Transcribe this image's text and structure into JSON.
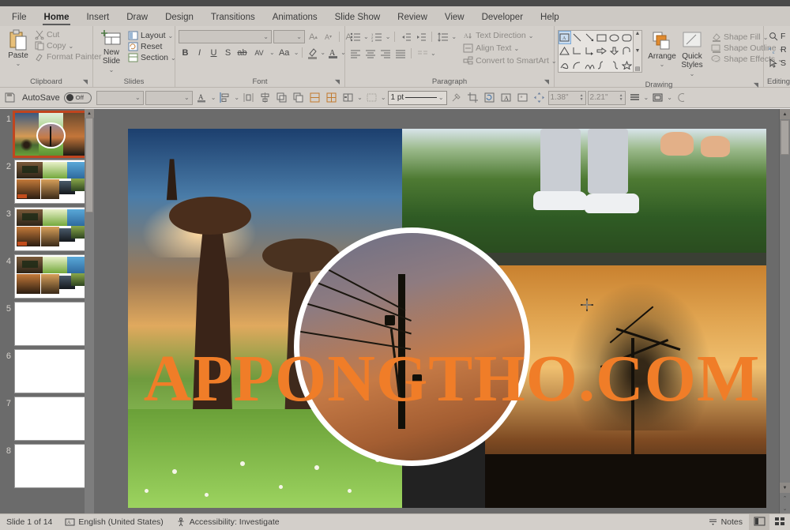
{
  "tabs": [
    {
      "label": "File",
      "active": false
    },
    {
      "label": "Home",
      "active": true
    },
    {
      "label": "Insert",
      "active": false
    },
    {
      "label": "Draw",
      "active": false
    },
    {
      "label": "Design",
      "active": false
    },
    {
      "label": "Transitions",
      "active": false
    },
    {
      "label": "Animations",
      "active": false
    },
    {
      "label": "Slide Show",
      "active": false
    },
    {
      "label": "Review",
      "active": false
    },
    {
      "label": "View",
      "active": false
    },
    {
      "label": "Developer",
      "active": false
    },
    {
      "label": "Help",
      "active": false
    }
  ],
  "ribbon": {
    "clipboard": {
      "label": "Clipboard",
      "paste": "Paste",
      "cut": "Cut",
      "copy": "Copy",
      "format_painter": "Format Painter"
    },
    "slides": {
      "label": "Slides",
      "new_slide": "New\nSlide",
      "new_slide_line1": "New",
      "new_slide_line2": "Slide",
      "layout": "Layout",
      "reset": "Reset",
      "section": "Section"
    },
    "font": {
      "label": "Font",
      "font_name_value": "",
      "font_name_placeholder": "",
      "font_size_value": "",
      "bold": "B",
      "italic": "I",
      "underline": "U",
      "shadow": "S",
      "strikethrough": "ab",
      "char_spacing": "AV",
      "change_case": "Aa",
      "increase_size": "A",
      "decrease_size": "A",
      "clear_formatting": "A",
      "text_highlight": "A",
      "font_color": "A"
    },
    "paragraph": {
      "label": "Paragraph",
      "text_direction": "Text Direction",
      "align_text": "Align Text",
      "convert_smartart": "Convert to SmartArt"
    },
    "drawing": {
      "label": "Drawing",
      "arrange": "Arrange",
      "quick_styles_line1": "Quick",
      "quick_styles_line2": "Styles",
      "shape_fill": "Shape Fill",
      "shape_outline": "Shape Outline",
      "shape_effects": "Shape Effects"
    },
    "editing": {
      "label": "Editing",
      "find": "F",
      "replace": "R",
      "select": "S"
    }
  },
  "quicktoolbar": {
    "autosave_label": "AutoSave",
    "autosave_state": "Off",
    "combo1_value": "",
    "combo2_value": "",
    "line_weight": "1 pt",
    "width_value": "1.38\"",
    "height_value": "2.21\""
  },
  "thumbnails": [
    {
      "number": "1",
      "selected": true,
      "kind": "collage-hero"
    },
    {
      "number": "2",
      "selected": false,
      "kind": "collage-grid"
    },
    {
      "number": "3",
      "selected": false,
      "kind": "collage-grid"
    },
    {
      "number": "4",
      "selected": false,
      "kind": "collage-grid"
    },
    {
      "number": "5",
      "selected": false,
      "kind": "blank"
    },
    {
      "number": "6",
      "selected": false,
      "kind": "blank"
    },
    {
      "number": "7",
      "selected": false,
      "kind": "blank"
    },
    {
      "number": "8",
      "selected": false,
      "kind": "blank"
    }
  ],
  "slide": {
    "watermark_text": "APPONGTHO.COM",
    "watermark_color": "#f07d28"
  },
  "status": {
    "slide_count": "Slide 1 of 14",
    "language": "English (United States)",
    "accessibility": "Accessibility: Investigate",
    "notes": "Notes"
  },
  "colors": {
    "ribbon_bg": "#d3cfca",
    "tabbar_bg": "#cdc9c4",
    "workspace_bg": "#6b6b6b",
    "selection": "#c0451f",
    "accent_orange": "#f07d28"
  }
}
